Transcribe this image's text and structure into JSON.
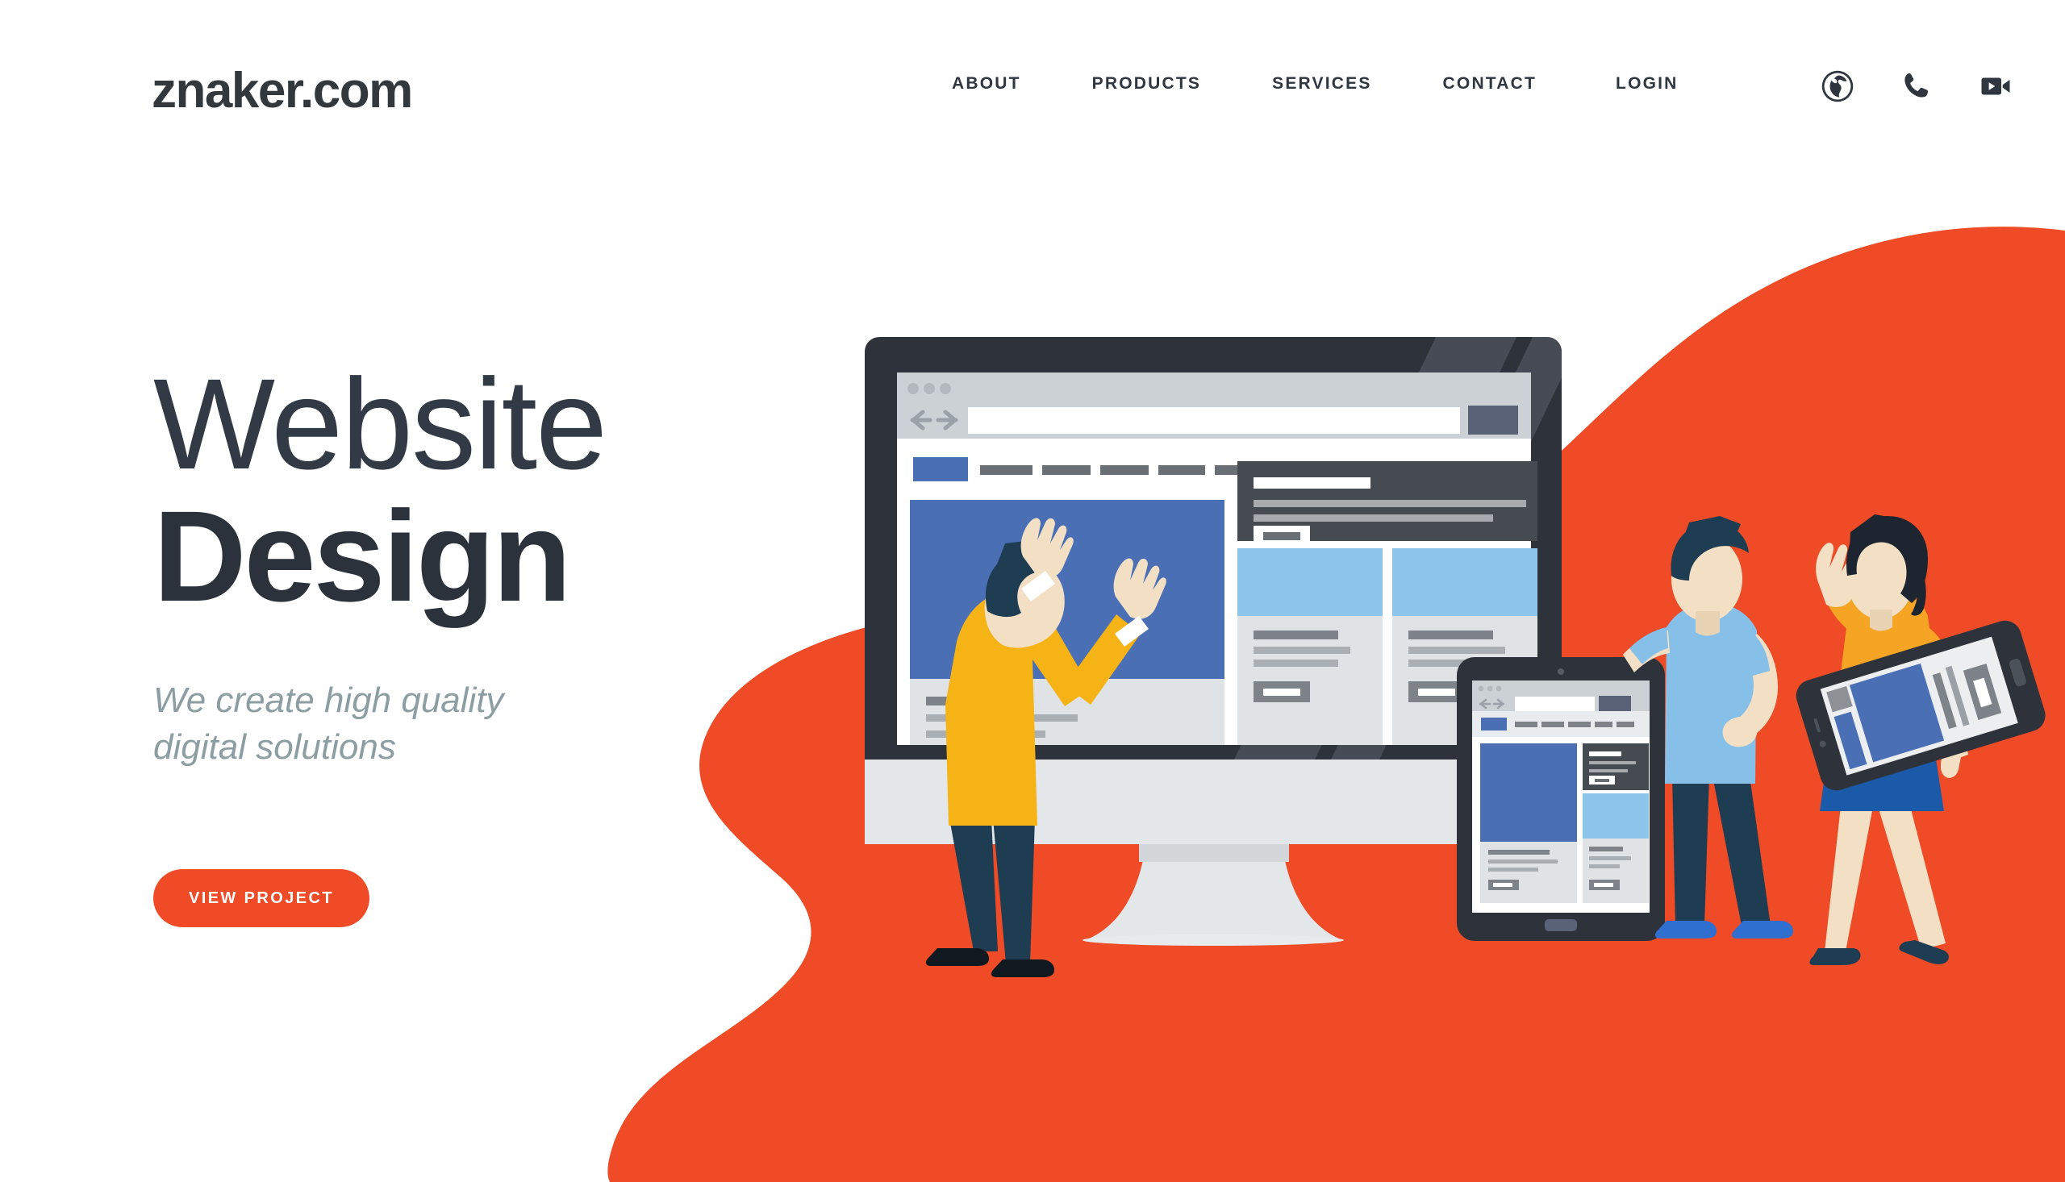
{
  "header": {
    "logo": "znaker.com",
    "nav": [
      {
        "label": "ABOUT",
        "name": "nav-about"
      },
      {
        "label": "PRODUCTS",
        "name": "nav-products"
      },
      {
        "label": "SERVICES",
        "name": "nav-services"
      },
      {
        "label": "CONTACT",
        "name": "nav-contact"
      },
      {
        "label": "LOGIN",
        "name": "nav-login"
      }
    ],
    "icons": [
      {
        "name": "globe-icon",
        "glyph": "globe"
      },
      {
        "name": "phone-icon",
        "glyph": "phone"
      },
      {
        "name": "video-camera-icon",
        "glyph": "video"
      }
    ]
  },
  "hero": {
    "headline_light": "Website",
    "headline_bold": "Design",
    "subhead_line1": "We create high quality",
    "subhead_line2": "digital solutions",
    "cta_label": "VIEW PROJECT"
  },
  "colors": {
    "accent_orange": "#ee4b26",
    "headline_dark": "#2b323c",
    "subhead_gray": "#8c9ea1",
    "device_bezel": "#2e333b",
    "device_body_light": "#e4e7ea",
    "wireframe_blue": "#4a6fb5",
    "wireframe_lightblue": "#8cc6ea",
    "wireframe_dark": "#464b52",
    "shirt_yellow": "#f5b315",
    "shirt_lightblue": "#86bfe8",
    "skin": "#f3e0c4",
    "hair_dark": "#1f2b3a",
    "jeans_navy": "#1e3d52",
    "skirt_blue": "#1a5aa8",
    "top_orange": "#f5a423"
  },
  "illustration": {
    "monitor": {
      "name": "desktop-monitor",
      "browser_dots": 3,
      "nav_blocks": 5
    },
    "tablet": {
      "name": "tablet-device"
    },
    "phone": {
      "name": "smartphone-device"
    },
    "people": [
      {
        "name": "person-yellow-sweater"
      },
      {
        "name": "person-blue-tshirt"
      },
      {
        "name": "person-orange-top"
      }
    ]
  }
}
